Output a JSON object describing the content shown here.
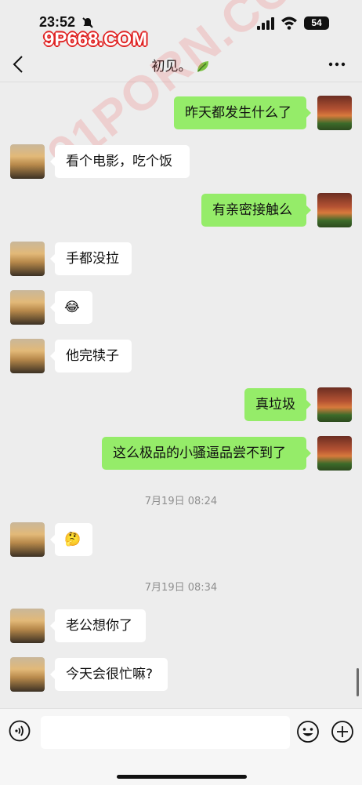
{
  "status_bar": {
    "time": "23:52",
    "battery": "54"
  },
  "watermark": {
    "top": "9P668.COM",
    "middle": "91PORN.COM"
  },
  "header": {
    "title": "初见。"
  },
  "messages": [
    {
      "side": "right",
      "text": "昨天都发生什么了"
    },
    {
      "side": "left",
      "text": "看个电影，吃个饭"
    },
    {
      "side": "right",
      "text": "有亲密接触么"
    },
    {
      "side": "left",
      "text": "手都没拉"
    },
    {
      "side": "left",
      "text": "😂"
    },
    {
      "side": "left",
      "text": "他完犊子"
    },
    {
      "side": "right",
      "text": "真垃圾"
    },
    {
      "side": "right",
      "text": "这么极品的小骚逼品尝不到了"
    },
    {
      "side": "left",
      "text": "🤔"
    },
    {
      "side": "left",
      "text": "老公想你了"
    },
    {
      "side": "left",
      "text": "今天会很忙嘛?"
    }
  ],
  "timestamps": [
    "7月19日 08:24",
    "7月19日 08:34"
  ],
  "colors": {
    "background": "#ededed",
    "sent_bubble": "#95ec69",
    "received_bubble": "#ffffff"
  },
  "icons": {
    "back": "chevron-left-icon",
    "more": "more-dots-icon",
    "voice": "voice-icon",
    "emoji": "emoji-icon",
    "plus": "plus-icon"
  }
}
